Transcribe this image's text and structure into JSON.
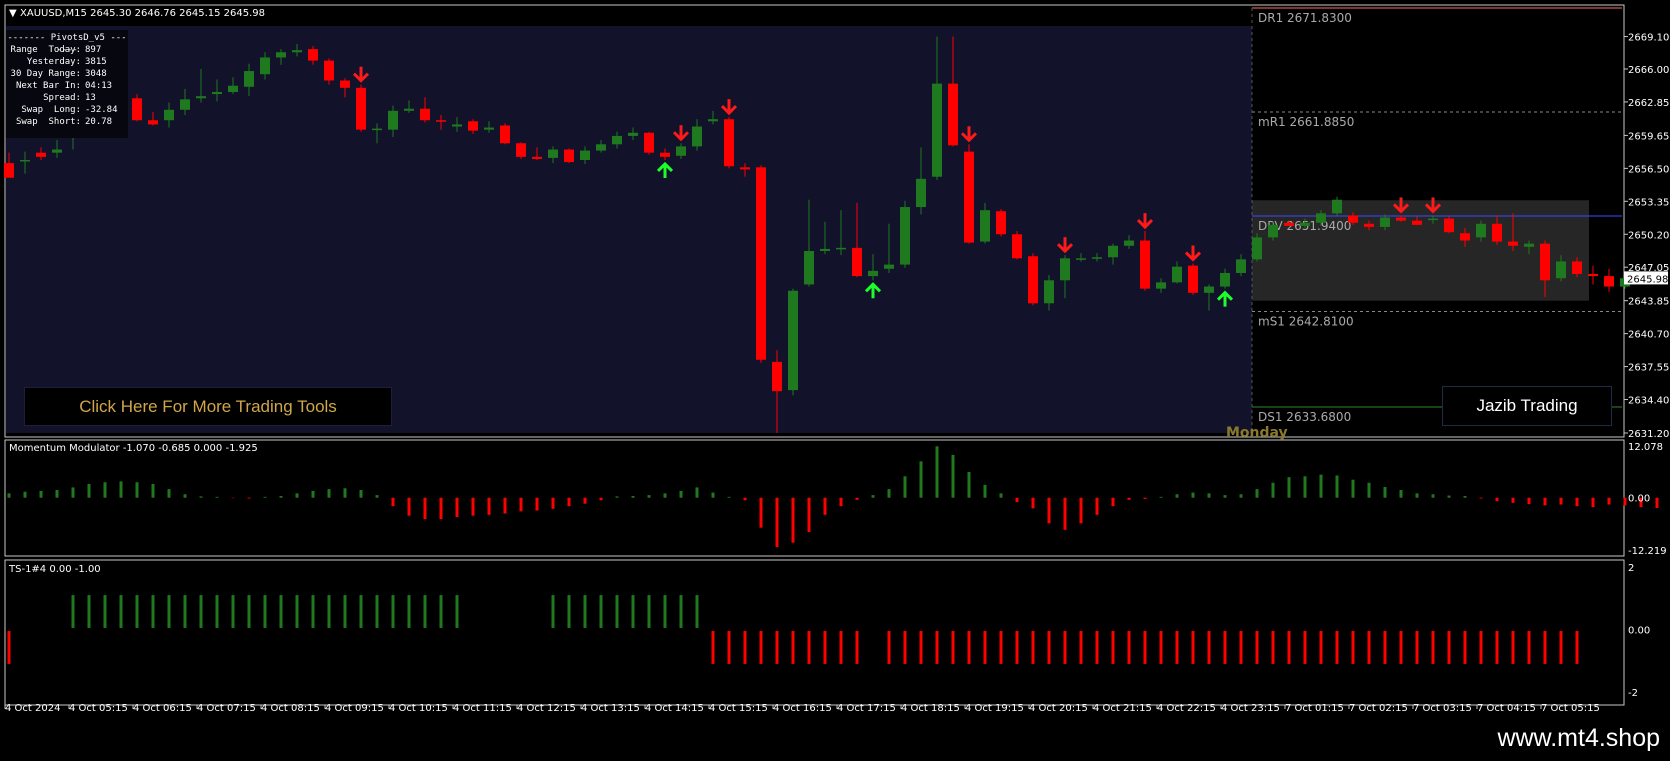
{
  "main_chart": {
    "header": "XAUUSD,M15  2645.30 2646.76 2645.15 2645.98",
    "colors": {
      "bull": "#1f7a1f",
      "bear": "#ff0000",
      "sell_arrow": "#ff1a1a",
      "buy_arrow": "#1cff2a",
      "session_bg": "#12122a",
      "box_bg": "#262626"
    },
    "candles": [
      [
        2657.0,
        2658.0,
        2655.6,
        2656.0
      ],
      [
        2657.3,
        2656.0,
        2657.3,
        2658.1
      ],
      [
        2658.0,
        2657.3,
        2657.6,
        2658.5
      ],
      [
        2658.0,
        2657.5,
        2658.3,
        2659.2
      ],
      [
        2659.6,
        2658.3,
        2661.9,
        2662.5
      ],
      [
        2661.9,
        2660.0,
        2663.1,
        2664.0
      ],
      [
        2663.2,
        2662.1,
        2663.8,
        2664.2
      ],
      [
        2663.8,
        2662.6,
        2663.2,
        2664.0
      ],
      [
        2663.2,
        2661.0,
        2661.1,
        2663.6
      ],
      [
        2661.1,
        2660.6,
        2660.7,
        2661.9
      ],
      [
        2661.1,
        2660.4,
        2662.1,
        2662.8
      ],
      [
        2662.1,
        2661.6,
        2663.1,
        2664.1
      ],
      [
        2663.2,
        2662.8,
        2663.4,
        2666.0
      ],
      [
        2663.6,
        2662.9,
        2663.8,
        2665.0
      ],
      [
        2663.8,
        2663.6,
        2664.4,
        2665.2
      ],
      [
        2664.3,
        2663.4,
        2665.8,
        2666.5
      ],
      [
        2665.5,
        2665.0,
        2667.1,
        2667.6
      ],
      [
        2667.1,
        2666.4,
        2667.6,
        2667.9
      ],
      [
        2667.6,
        2667.2,
        2667.8,
        2668.4
      ],
      [
        2667.9,
        2666.4,
        2666.8,
        2668.2
      ],
      [
        2666.8,
        2664.5,
        2664.9,
        2667.0
      ],
      [
        2664.9,
        2663.3,
        2664.2,
        2665.1
      ],
      [
        2664.2,
        2660.0,
        2660.2,
        2664.5
      ],
      [
        2660.2,
        2658.9,
        2660.3,
        2660.8
      ],
      [
        2660.2,
        2659.5,
        2662.0,
        2662.5
      ],
      [
        2662.0,
        2661.8,
        2662.2,
        2663.0
      ],
      [
        2662.2,
        2660.9,
        2661.1,
        2663.3
      ],
      [
        2661.1,
        2660.2,
        2661.0,
        2661.6
      ],
      [
        2660.5,
        2660.0,
        2660.7,
        2661.4
      ],
      [
        2661.0,
        2659.8,
        2660.1,
        2661.2
      ],
      [
        2660.2,
        2659.9,
        2660.4,
        2661.0
      ],
      [
        2660.6,
        2658.8,
        2658.9,
        2660.8
      ],
      [
        2658.9,
        2657.4,
        2657.6,
        2659.0
      ],
      [
        2657.6,
        2657.3,
        2657.4,
        2658.5
      ],
      [
        2657.5,
        2657.0,
        2658.3,
        2658.6
      ],
      [
        2658.3,
        2657.0,
        2657.1,
        2658.4
      ],
      [
        2657.3,
        2656.9,
        2658.2,
        2658.6
      ],
      [
        2658.2,
        2658.0,
        2658.8,
        2659.2
      ],
      [
        2658.8,
        2658.4,
        2659.6,
        2660.0
      ],
      [
        2659.6,
        2659.2,
        2659.9,
        2660.4
      ],
      [
        2659.9,
        2657.8,
        2658.0,
        2660.0
      ],
      [
        2658.0,
        2657.3,
        2657.6,
        2658.4
      ],
      [
        2657.7,
        2657.4,
        2658.6,
        2658.9
      ],
      [
        2658.6,
        2658.2,
        2660.5,
        2661.2
      ],
      [
        2661.0,
        2660.7,
        2661.2,
        2662.0
      ],
      [
        2661.2,
        2656.5,
        2656.7,
        2661.4
      ],
      [
        2656.6,
        2655.7,
        2656.4,
        2657.0
      ],
      [
        2656.6,
        2637.9,
        2638.2,
        2656.8
      ],
      [
        2638.0,
        2631.2,
        2635.2,
        2639.1
      ],
      [
        2635.3,
        2634.8,
        2644.8,
        2645.0
      ],
      [
        2645.4,
        2645.2,
        2648.6,
        2653.5
      ],
      [
        2648.6,
        2648.3,
        2648.8,
        2651.4
      ],
      [
        2648.8,
        2648.2,
        2648.9,
        2652.5
      ],
      [
        2648.9,
        2646.1,
        2646.2,
        2653.2
      ],
      [
        2646.2,
        2645.8,
        2646.7,
        2648.3
      ],
      [
        2646.9,
        2646.5,
        2647.3,
        2651.2
      ],
      [
        2647.3,
        2647.0,
        2652.8,
        2653.4
      ],
      [
        2652.8,
        2652.1,
        2655.5,
        2658.5
      ],
      [
        2655.7,
        2655.4,
        2664.6,
        2669.1
      ],
      [
        2664.6,
        2658.6,
        2658.7,
        2669.1
      ],
      [
        2658.1,
        2649.3,
        2649.4,
        2658.8
      ],
      [
        2649.5,
        2649.3,
        2652.5,
        2653.2
      ],
      [
        2652.4,
        2650.0,
        2650.2,
        2652.6
      ],
      [
        2650.2,
        2647.8,
        2647.9,
        2650.5
      ],
      [
        2648.1,
        2643.4,
        2643.6,
        2648.4
      ],
      [
        2643.6,
        2642.9,
        2645.8,
        2646.3
      ],
      [
        2645.8,
        2644.1,
        2647.9,
        2648.2
      ],
      [
        2647.9,
        2647.6,
        2647.9,
        2648.4
      ],
      [
        2647.9,
        2647.6,
        2648.0,
        2648.4
      ],
      [
        2648.0,
        2647.3,
        2649.1,
        2649.3
      ],
      [
        2649.1,
        2648.8,
        2649.6,
        2650.1
      ],
      [
        2649.6,
        2644.8,
        2645.0,
        2650.5
      ],
      [
        2645.0,
        2644.6,
        2645.6,
        2646.0
      ],
      [
        2645.6,
        2645.5,
        2647.1,
        2647.6
      ],
      [
        2647.2,
        2644.4,
        2644.6,
        2647.4
      ],
      [
        2644.6,
        2642.9,
        2645.2,
        2645.4
      ],
      [
        2645.2,
        2645.0,
        2646.5,
        2646.9
      ],
      [
        2646.5,
        2646.2,
        2647.8,
        2648.3
      ],
      [
        2647.8,
        2647.6,
        2649.9,
        2650.3
      ],
      [
        2649.9,
        2649.6,
        2651.1,
        2651.4
      ],
      [
        2651.3,
        2651.1,
        2651.0,
        2651.5
      ],
      [
        2651.0,
        2650.8,
        2651.3,
        2651.7
      ],
      [
        2651.3,
        2651.0,
        2652.2,
        2652.5
      ],
      [
        2652.2,
        2652.0,
        2653.5,
        2653.8
      ],
      [
        2652.0,
        2651.1,
        2651.3,
        2652.3
      ],
      [
        2651.2,
        2650.6,
        2650.9,
        2651.5
      ],
      [
        2650.9,
        2650.6,
        2651.8,
        2652.1
      ],
      [
        2651.8,
        2651.4,
        2651.5,
        2652.0
      ],
      [
        2651.5,
        2651.1,
        2651.1,
        2651.9
      ],
      [
        2651.6,
        2651.2,
        2651.7,
        2652.0
      ],
      [
        2651.7,
        2650.3,
        2650.4,
        2651.9
      ],
      [
        2650.3,
        2649.0,
        2649.6,
        2650.8
      ],
      [
        2649.9,
        2649.5,
        2651.2,
        2651.5
      ],
      [
        2651.2,
        2649.2,
        2649.5,
        2652.0
      ],
      [
        2649.5,
        2648.6,
        2649.1,
        2652.2
      ],
      [
        2649.0,
        2648.3,
        2649.3,
        2649.6
      ],
      [
        2649.3,
        2644.2,
        2645.8,
        2649.6
      ],
      [
        2646.0,
        2645.7,
        2647.6,
        2648.2
      ],
      [
        2647.6,
        2646.1,
        2646.4,
        2648.0
      ],
      [
        2646.4,
        2645.4,
        2646.2,
        2647.2
      ],
      [
        2646.2,
        2644.7,
        2645.2,
        2646.9
      ],
      [
        2645.2,
        2645.0,
        2646.0,
        2646.5
      ]
    ],
    "sell_arrows": [
      22,
      42,
      45,
      60,
      66,
      71,
      74,
      87,
      89
    ],
    "buy_arrows": [
      41,
      54,
      76
    ],
    "session_label": "Monday",
    "y_axis": [
      "2669.10",
      "2666.00",
      "2662.85",
      "2659.65",
      "2656.50",
      "2653.35",
      "2650.20",
      "2647.05",
      "2643.85",
      "2640.70",
      "2637.55",
      "2634.40",
      "2631.20"
    ],
    "current_price": "2645.98",
    "pivots": [
      {
        "name": "DR1",
        "value": "2671.8300",
        "price": 2671.83,
        "color": "#ff6a6a",
        "style": "solid"
      },
      {
        "name": "mR1",
        "value": "2661.8850",
        "price": 2661.885,
        "color": "#888",
        "style": "dashed"
      },
      {
        "name": "DPV",
        "value": "2651.9400",
        "price": 2651.94,
        "color": "#3b4bff",
        "style": "solid"
      },
      {
        "name": "mS1",
        "value": "2642.8100",
        "price": 2642.81,
        "color": "#888",
        "style": "dashed"
      },
      {
        "name": "DS1",
        "value": "2633.6800",
        "price": 2633.68,
        "color": "#2a8a2a",
        "style": "solid"
      }
    ]
  },
  "info_panel": {
    "title": "-------  PivotsD_v5  -------",
    "rows": [
      {
        "label": "Range  Today:",
        "value": "897"
      },
      {
        "label": "Yesterday:",
        "value": "3815"
      },
      {
        "label": "30 Day Range:",
        "value": "3048"
      },
      {
        "label": "Next Bar In:",
        "value": "04:13"
      },
      {
        "label": "Spread:",
        "value": "13"
      },
      {
        "label": "Swap  Long:",
        "value": "-32.84"
      },
      {
        "label": "Swap  Short:",
        "value": "20.78"
      }
    ]
  },
  "buttons": {
    "tools_label": "Click Here For More Trading Tools",
    "brand_label": "Jazib Trading"
  },
  "momentum": {
    "header": "Momentum Modulator -1.070 -0.685 0.000 -1.925",
    "y_axis": [
      "12.078",
      "0.00",
      "-12.219"
    ],
    "values": [
      1.0,
      1.4,
      1.6,
      1.8,
      2.4,
      3.2,
      3.6,
      3.8,
      3.6,
      3.2,
      2.0,
      0.8,
      0.3,
      0.2,
      -0.1,
      -0.2,
      0.2,
      0.4,
      1.0,
      1.6,
      2.0,
      2.2,
      1.8,
      0.6,
      -2.0,
      -4.2,
      -5.0,
      -5.0,
      -4.5,
      -4.2,
      -4.0,
      -3.7,
      -3.2,
      -3.0,
      -2.6,
      -2.0,
      -1.4,
      -0.6,
      0.3,
      0.4,
      0.6,
      1.0,
      1.6,
      2.4,
      1.2,
      0.2,
      -0.6,
      -7.0,
      -11.5,
      -10.5,
      -8.0,
      -4.0,
      -2.0,
      -0.5,
      0.6,
      2.0,
      5.0,
      8.5,
      12.0,
      10.0,
      6.0,
      3.0,
      1.0,
      -1.0,
      -2.5,
      -6.0,
      -7.5,
      -6.0,
      -4.0,
      -2.0,
      -0.5,
      -0.3,
      0.2,
      0.8,
      1.2,
      1.0,
      0.6,
      0.8,
      2.0,
      3.5,
      4.8,
      5.0,
      5.4,
      5.2,
      4.2,
      3.5,
      2.5,
      1.8,
      1.0,
      0.8,
      0.5,
      0.4,
      -0.2,
      -0.8,
      -1.2,
      -1.5,
      -1.8,
      -1.6,
      -2.0,
      -2.2,
      -1.6,
      -1.8,
      -2.2,
      -2.4,
      -2.4,
      -2.2,
      -2.2
    ]
  },
  "ts": {
    "header": "TS-1#4 0.00 -1.00",
    "y_axis": [
      "2",
      "0.00",
      "-2"
    ],
    "values": [
      -1,
      0,
      0,
      0,
      1,
      1,
      1,
      1,
      1,
      1,
      1,
      1,
      1,
      1,
      1,
      1,
      1,
      1,
      1,
      1,
      1,
      1,
      1,
      1,
      1,
      1,
      1,
      1,
      1,
      0,
      0,
      0,
      0,
      0,
      1,
      1,
      1,
      1,
      1,
      1,
      1,
      1,
      1,
      1,
      -1,
      -1,
      -1,
      -1,
      -1,
      -1,
      -1,
      -1,
      -1,
      -1,
      0,
      -1,
      -1,
      -1,
      -1,
      -1,
      -1,
      -1,
      -1,
      -1,
      -1,
      -1,
      -1,
      -1,
      -1,
      -1,
      -1,
      -1,
      -1,
      -1,
      -1,
      -1,
      -1,
      -1,
      -1,
      -1,
      -1,
      -1,
      -1,
      -1,
      -1,
      -1,
      -1,
      -1,
      -1,
      -1,
      -1,
      -1,
      -1,
      -1,
      -1,
      -1,
      -1,
      -1,
      -1
    ]
  },
  "time_axis": [
    "4 Oct 2024",
    "4 Oct 05:15",
    "4 Oct 06:15",
    "4 Oct 07:15",
    "4 Oct 08:15",
    "4 Oct 09:15",
    "4 Oct 10:15",
    "4 Oct 11:15",
    "4 Oct 12:15",
    "4 Oct 13:15",
    "4 Oct 14:15",
    "4 Oct 15:15",
    "4 Oct 16:15",
    "4 Oct 17:15",
    "4 Oct 18:15",
    "4 Oct 19:15",
    "4 Oct 20:15",
    "4 Oct 21:15",
    "4 Oct 22:15",
    "4 Oct 23:15",
    "7 Oct 01:15",
    "7 Oct 02:15",
    "7 Oct 03:15",
    "7 Oct 04:15",
    "7 Oct 05:15"
  ],
  "watermark": "www.mt4.shop"
}
